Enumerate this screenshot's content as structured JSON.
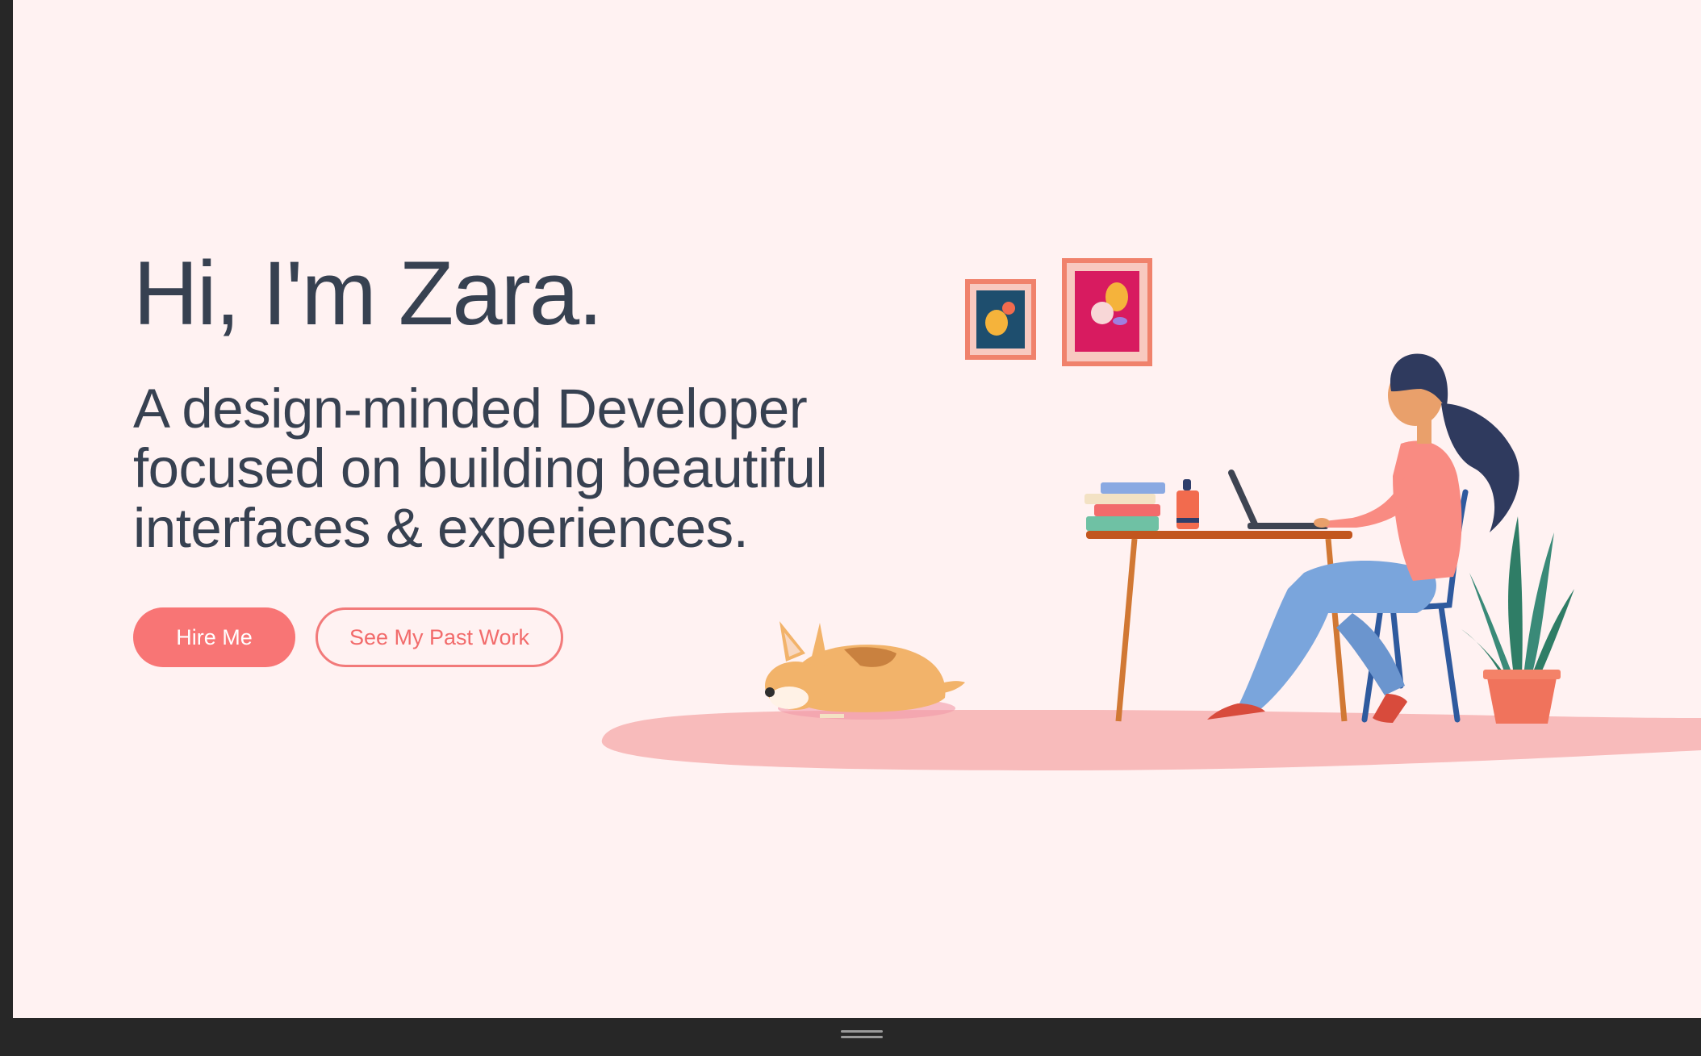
{
  "hero": {
    "title": "Hi, I'm Zara.",
    "subtitle": "A design-minded Developer focused on building beautiful interfaces & experiences.",
    "primary_button": "Hire Me",
    "secondary_button": "See My Past Work"
  },
  "illustration": {
    "subject": "woman-working-at-laptop-with-dog",
    "colors": {
      "background": "#FFF2F2",
      "rug": "#F8BBBB",
      "accent": "#F87575",
      "text": "#374151"
    }
  }
}
